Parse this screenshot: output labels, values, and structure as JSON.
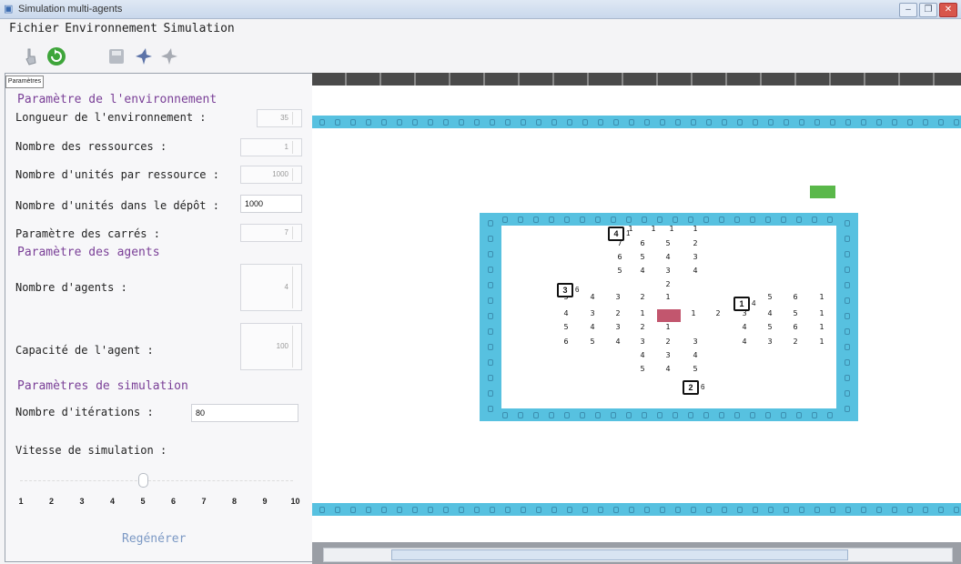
{
  "window": {
    "title": "Simulation multi-agents",
    "controls": [
      "‒",
      "❐",
      "✕"
    ]
  },
  "menu": [
    {
      "label": "Fichier"
    },
    {
      "label": "Environnement"
    },
    {
      "label": "Simulation"
    }
  ],
  "toolbar": {
    "icons": [
      "hand-pointer-icon",
      "refresh-icon",
      "save-icon",
      "bird-icon",
      "bird-gray-icon"
    ]
  },
  "panel": {
    "tab_label": "Paramètres",
    "sections": {
      "environment": "Paramètre de l'environnement",
      "agents": "Paramètre des agents",
      "simulation": "Paramètres de simulation"
    },
    "fields": {
      "length_label": "Longueur de l'environnement :",
      "length_value": "35",
      "resources_label": "Nombre des ressources :",
      "resources_value": "1",
      "units_per_resource_label": "Nombre d'unités par ressource :",
      "units_per_resource_value": "1000",
      "units_in_depot_label": "Nombre d'unités dans le dépôt :",
      "units_in_depot_value": "1000",
      "squares_label": "Paramètre des carrés :",
      "squares_value": "7",
      "agents_count_label": "Nombre d'agents :",
      "agents_count_value": "4",
      "capacity_label": "Capacité de l'agent :",
      "capacity_value": "100",
      "iterations_label": "Nombre d'itérations :",
      "iterations_value": "80",
      "speed_label": "Vitesse de simulation :"
    },
    "slider": {
      "ticks": [
        "1",
        "2",
        "3",
        "4",
        "5",
        "6",
        "7",
        "8",
        "9",
        "10"
      ],
      "value": 5
    },
    "regen_label": "Regénérer"
  },
  "simulation": {
    "agents": [
      {
        "label": "4",
        "count": "1"
      },
      {
        "label": "3",
        "count": "6"
      },
      {
        "label": "1",
        "count": "4"
      },
      {
        "label": "2",
        "count": "6"
      }
    ],
    "colors": {
      "band": "#57c1e0",
      "depot": "#c2566e",
      "resource": "#5ab84a"
    }
  }
}
